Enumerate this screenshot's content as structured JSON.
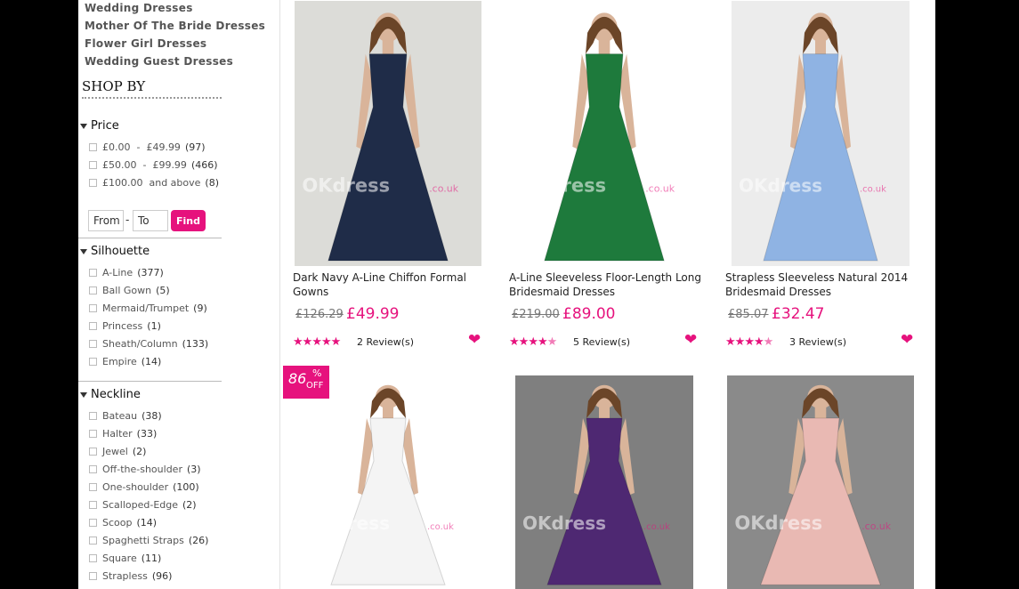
{
  "categories": [
    "Wedding Dresses",
    "Mother Of The Bride Dresses",
    "Flower Girl Dresses",
    "Wedding Guest Dresses"
  ],
  "shop_by_title": "SHOP BY",
  "price": {
    "title": "Price",
    "options": [
      {
        "label": "£0.00  -  £49.99",
        "count": "(97)"
      },
      {
        "label": "£50.00  -  £99.99",
        "count": "(466)"
      },
      {
        "label": "£100.00  and above",
        "count": "(8)"
      }
    ],
    "from_placeholder": "From",
    "to_placeholder": "To",
    "find_label": "Find"
  },
  "silhouette": {
    "title": "Silhouette",
    "options": [
      {
        "label": "A-Line",
        "count": "(377)"
      },
      {
        "label": "Ball Gown",
        "count": "(5)"
      },
      {
        "label": "Mermaid/Trumpet",
        "count": "(9)"
      },
      {
        "label": "Princess",
        "count": "(1)"
      },
      {
        "label": "Sheath/Column",
        "count": "(133)"
      },
      {
        "label": "Empire",
        "count": "(14)"
      }
    ]
  },
  "neckline": {
    "title": "Neckline",
    "options": [
      {
        "label": "Bateau",
        "count": "(38)"
      },
      {
        "label": "Halter",
        "count": "(33)"
      },
      {
        "label": "Jewel",
        "count": "(2)"
      },
      {
        "label": "Off-the-shoulder",
        "count": "(3)"
      },
      {
        "label": "One-shoulder",
        "count": "(100)"
      },
      {
        "label": "Scalloped-Edge",
        "count": "(2)"
      },
      {
        "label": "Scoop",
        "count": "(14)"
      },
      {
        "label": "Spaghetti Straps",
        "count": "(26)"
      },
      {
        "label": "Square",
        "count": "(11)"
      },
      {
        "label": "Strapless",
        "count": "(96)"
      }
    ]
  },
  "products": [
    {
      "name_line1": "Dark Navy A-Line Chiffon Formal",
      "name_line2": "Gowns",
      "old_price": "£126.29",
      "new_price": "£49.99",
      "rating": 5,
      "reviews": "2 Review(s)",
      "dress_color": "#1f2c48",
      "bg_color": "#dcdcd8"
    },
    {
      "name_line1": "A-Line Sleeveless Floor-Length Long",
      "name_line2": "Bridesmaid Dresses",
      "old_price": "£219.00",
      "new_price": "£89.00",
      "rating": 4.5,
      "reviews": "5 Review(s)",
      "dress_color": "#1e7a3c",
      "bg_color": "#ffffff"
    },
    {
      "name_line1": "Strapless Sleeveless Natural 2014",
      "name_line2": "Bridesmaid Dresses",
      "old_price": "£85.07",
      "new_price": "£32.47",
      "rating": 4.5,
      "reviews": "3 Review(s)",
      "dress_color": "#8fb3e3",
      "bg_color": "#ececec"
    },
    {
      "dress_color": "#f4f4f4",
      "bg_color": "#ffffff",
      "discount": "86",
      "discount_pct": "%",
      "discount_off": "OFF"
    },
    {
      "dress_color": "#4e2872",
      "bg_color": "#7f7f7f"
    },
    {
      "dress_color": "#e9b9b3",
      "bg_color": "#8a8a8a"
    }
  ],
  "watermark": {
    "brand": "OKdress",
    "suffix": ".co.uk"
  },
  "icons": {
    "heart": "heart-icon",
    "star": "star-icon",
    "collapse": "triangle-down-icon"
  },
  "accent_color": "#e6127d"
}
